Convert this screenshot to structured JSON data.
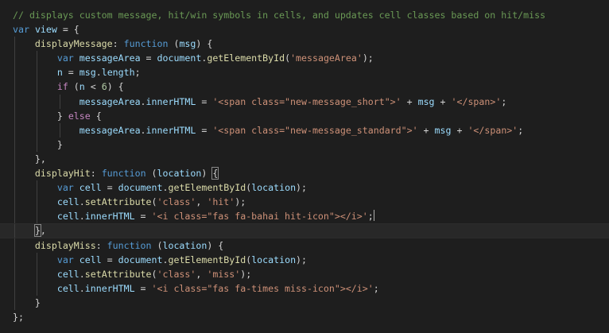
{
  "editor": {
    "colors": {
      "background": "#1e1e1e",
      "comment": "#6a9955",
      "keyword": "#569cd6",
      "variable": "#9cdcfe",
      "function": "#dcdcaa",
      "string": "#ce9178",
      "number": "#b5cea8",
      "control": "#c586c0",
      "text": "#d4d4d4"
    },
    "lines": [
      {
        "tokens": [
          {
            "t": "comment",
            "v": "// displays custom message, hit/win symbols in cells, and updates cell classes based on hit/miss"
          }
        ]
      },
      {
        "tokens": [
          {
            "t": "kw",
            "v": "var"
          },
          {
            "t": "punc",
            "v": " "
          },
          {
            "t": "var",
            "v": "view"
          },
          {
            "t": "punc",
            "v": " = {"
          }
        ]
      },
      {
        "indent": 1,
        "tokens": [
          {
            "t": "fn",
            "v": "displayMessage"
          },
          {
            "t": "punc",
            "v": ": "
          },
          {
            "t": "kw",
            "v": "function"
          },
          {
            "t": "punc",
            "v": " ("
          },
          {
            "t": "var",
            "v": "msg"
          },
          {
            "t": "punc",
            "v": ") {"
          }
        ]
      },
      {
        "indent": 2,
        "tokens": [
          {
            "t": "kw",
            "v": "var"
          },
          {
            "t": "punc",
            "v": " "
          },
          {
            "t": "var",
            "v": "messageArea"
          },
          {
            "t": "punc",
            "v": " = "
          },
          {
            "t": "var",
            "v": "document"
          },
          {
            "t": "punc",
            "v": "."
          },
          {
            "t": "fn",
            "v": "getElementById"
          },
          {
            "t": "punc",
            "v": "("
          },
          {
            "t": "str",
            "v": "'messageArea'"
          },
          {
            "t": "punc",
            "v": ");"
          }
        ]
      },
      {
        "indent": 2,
        "tokens": [
          {
            "t": "var",
            "v": "n"
          },
          {
            "t": "punc",
            "v": " = "
          },
          {
            "t": "var",
            "v": "msg"
          },
          {
            "t": "punc",
            "v": "."
          },
          {
            "t": "var",
            "v": "length"
          },
          {
            "t": "punc",
            "v": ";"
          }
        ]
      },
      {
        "indent": 2,
        "tokens": [
          {
            "t": "ctrl",
            "v": "if"
          },
          {
            "t": "punc",
            "v": " ("
          },
          {
            "t": "var",
            "v": "n"
          },
          {
            "t": "punc",
            "v": " < "
          },
          {
            "t": "num",
            "v": "6"
          },
          {
            "t": "punc",
            "v": ") {"
          }
        ]
      },
      {
        "indent": 3,
        "tokens": [
          {
            "t": "var",
            "v": "messageArea"
          },
          {
            "t": "punc",
            "v": "."
          },
          {
            "t": "var",
            "v": "innerHTML"
          },
          {
            "t": "punc",
            "v": " = "
          },
          {
            "t": "str",
            "v": "'<span class=\"new-message_short\">'"
          },
          {
            "t": "punc",
            "v": " + "
          },
          {
            "t": "var",
            "v": "msg"
          },
          {
            "t": "punc",
            "v": " + "
          },
          {
            "t": "str",
            "v": "'</span>'"
          },
          {
            "t": "punc",
            "v": ";"
          }
        ]
      },
      {
        "indent": 2,
        "tokens": [
          {
            "t": "punc",
            "v": "} "
          },
          {
            "t": "ctrl",
            "v": "else"
          },
          {
            "t": "punc",
            "v": " {"
          }
        ]
      },
      {
        "indent": 3,
        "tokens": [
          {
            "t": "var",
            "v": "messageArea"
          },
          {
            "t": "punc",
            "v": "."
          },
          {
            "t": "var",
            "v": "innerHTML"
          },
          {
            "t": "punc",
            "v": " = "
          },
          {
            "t": "str",
            "v": "'<span class=\"new-message_standard\">'"
          },
          {
            "t": "punc",
            "v": " + "
          },
          {
            "t": "var",
            "v": "msg"
          },
          {
            "t": "punc",
            "v": " + "
          },
          {
            "t": "str",
            "v": "'</span>'"
          },
          {
            "t": "punc",
            "v": ";"
          }
        ]
      },
      {
        "indent": 2,
        "tokens": [
          {
            "t": "punc",
            "v": "}"
          }
        ]
      },
      {
        "indent": 1,
        "tokens": [
          {
            "t": "punc",
            "v": "},"
          }
        ]
      },
      {
        "indent": 1,
        "tokens": [
          {
            "t": "fn",
            "v": "displayHit"
          },
          {
            "t": "punc",
            "v": ": "
          },
          {
            "t": "kw",
            "v": "function"
          },
          {
            "t": "punc",
            "v": " ("
          },
          {
            "t": "var",
            "v": "location"
          },
          {
            "t": "punc",
            "v": ") "
          },
          {
            "t": "match",
            "v": "{"
          }
        ]
      },
      {
        "indent": 2,
        "tokens": [
          {
            "t": "kw",
            "v": "var"
          },
          {
            "t": "punc",
            "v": " "
          },
          {
            "t": "var",
            "v": "cell"
          },
          {
            "t": "punc",
            "v": " = "
          },
          {
            "t": "var",
            "v": "document"
          },
          {
            "t": "punc",
            "v": "."
          },
          {
            "t": "fn",
            "v": "getElementById"
          },
          {
            "t": "punc",
            "v": "("
          },
          {
            "t": "var",
            "v": "location"
          },
          {
            "t": "punc",
            "v": ");"
          }
        ]
      },
      {
        "indent": 2,
        "tokens": [
          {
            "t": "var",
            "v": "cell"
          },
          {
            "t": "punc",
            "v": "."
          },
          {
            "t": "fn",
            "v": "setAttribute"
          },
          {
            "t": "punc",
            "v": "("
          },
          {
            "t": "str",
            "v": "'class'"
          },
          {
            "t": "punc",
            "v": ", "
          },
          {
            "t": "str",
            "v": "'hit'"
          },
          {
            "t": "punc",
            "v": ");"
          }
        ]
      },
      {
        "indent": 2,
        "tokens": [
          {
            "t": "var",
            "v": "cell"
          },
          {
            "t": "punc",
            "v": "."
          },
          {
            "t": "var",
            "v": "innerHTML"
          },
          {
            "t": "punc",
            "v": " = "
          },
          {
            "t": "str",
            "v": "'<i class=\"fas fa-bahai hit-icon\"></i>'"
          },
          {
            "t": "punc",
            "v": ";"
          },
          {
            "t": "cursor",
            "v": ""
          }
        ]
      },
      {
        "indent": 1,
        "current": true,
        "tokens": [
          {
            "t": "match",
            "v": "}"
          },
          {
            "t": "punc",
            "v": ","
          }
        ]
      },
      {
        "indent": 1,
        "tokens": [
          {
            "t": "fn",
            "v": "displayMiss"
          },
          {
            "t": "punc",
            "v": ": "
          },
          {
            "t": "kw",
            "v": "function"
          },
          {
            "t": "punc",
            "v": " ("
          },
          {
            "t": "var",
            "v": "location"
          },
          {
            "t": "punc",
            "v": ") {"
          }
        ]
      },
      {
        "indent": 2,
        "tokens": [
          {
            "t": "kw",
            "v": "var"
          },
          {
            "t": "punc",
            "v": " "
          },
          {
            "t": "var",
            "v": "cell"
          },
          {
            "t": "punc",
            "v": " = "
          },
          {
            "t": "var",
            "v": "document"
          },
          {
            "t": "punc",
            "v": "."
          },
          {
            "t": "fn",
            "v": "getElementById"
          },
          {
            "t": "punc",
            "v": "("
          },
          {
            "t": "var",
            "v": "location"
          },
          {
            "t": "punc",
            "v": ");"
          }
        ]
      },
      {
        "indent": 2,
        "tokens": [
          {
            "t": "var",
            "v": "cell"
          },
          {
            "t": "punc",
            "v": "."
          },
          {
            "t": "fn",
            "v": "setAttribute"
          },
          {
            "t": "punc",
            "v": "("
          },
          {
            "t": "str",
            "v": "'class'"
          },
          {
            "t": "punc",
            "v": ", "
          },
          {
            "t": "str",
            "v": "'miss'"
          },
          {
            "t": "punc",
            "v": ");"
          }
        ]
      },
      {
        "indent": 2,
        "tokens": [
          {
            "t": "var",
            "v": "cell"
          },
          {
            "t": "punc",
            "v": "."
          },
          {
            "t": "var",
            "v": "innerHTML"
          },
          {
            "t": "punc",
            "v": " = "
          },
          {
            "t": "str",
            "v": "'<i class=\"fas fa-times miss-icon\"></i>'"
          },
          {
            "t": "punc",
            "v": ";"
          }
        ]
      },
      {
        "indent": 1,
        "tokens": [
          {
            "t": "punc",
            "v": "}"
          }
        ]
      },
      {
        "tokens": [
          {
            "t": "punc",
            "v": "};"
          }
        ]
      }
    ]
  }
}
